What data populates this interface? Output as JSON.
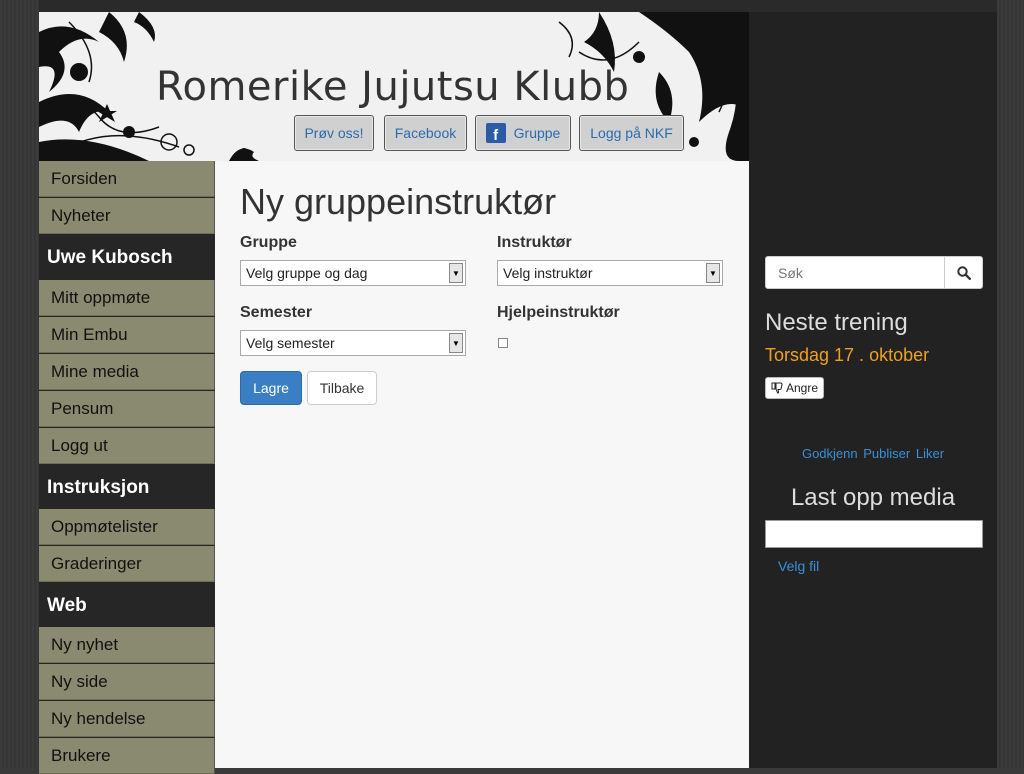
{
  "header": {
    "title": "Romerike Jujutsu Klubb",
    "buttons": {
      "try_us": "Prøv oss!",
      "facebook": "Facebook",
      "group_icon": "f",
      "group": "Gruppe",
      "login_nkf": "Logg på NKF"
    }
  },
  "nav": {
    "top_items": [
      "Forsiden",
      "Nyheter"
    ],
    "user_heading": "Uwe Kubosch",
    "user_items": [
      "Mitt oppmøte",
      "Min Embu",
      "Mine media",
      "Pensum",
      "Logg ut"
    ],
    "instruction_heading": "Instruksjon",
    "instruction_items": [
      "Oppmøtelister",
      "Graderinger"
    ],
    "web_heading": "Web",
    "web_items": [
      "Ny nyhet",
      "Ny side",
      "Ny hendelse",
      "Brukere"
    ]
  },
  "main": {
    "title": "Ny gruppeinstruktør",
    "group_label": "Gruppe",
    "group_value": "Velg gruppe og dag",
    "instructor_label": "Instruktør",
    "instructor_value": "Velg instruktør",
    "semester_label": "Semester",
    "semester_value": "Velg semester",
    "assistant_label": "Hjelpeinstruktør",
    "assistant_checked": false,
    "save_label": "Lagre",
    "back_label": "Tilbake"
  },
  "sidebar": {
    "search_placeholder": "Søk",
    "next_training_title": "Neste trening",
    "next_training_date": "Torsdag 17 . oktober",
    "undo_label": "Angre",
    "links": [
      "Godkjenn",
      "Publiser",
      "Liker"
    ],
    "upload_title": "Last opp media",
    "choose_file_label": "Velg fil"
  },
  "colors": {
    "nav_item_bg": "#8a8a70",
    "accent_orange": "#f0a020",
    "link_blue": "#3a8fd8",
    "primary_button": "#3a7fc4"
  }
}
